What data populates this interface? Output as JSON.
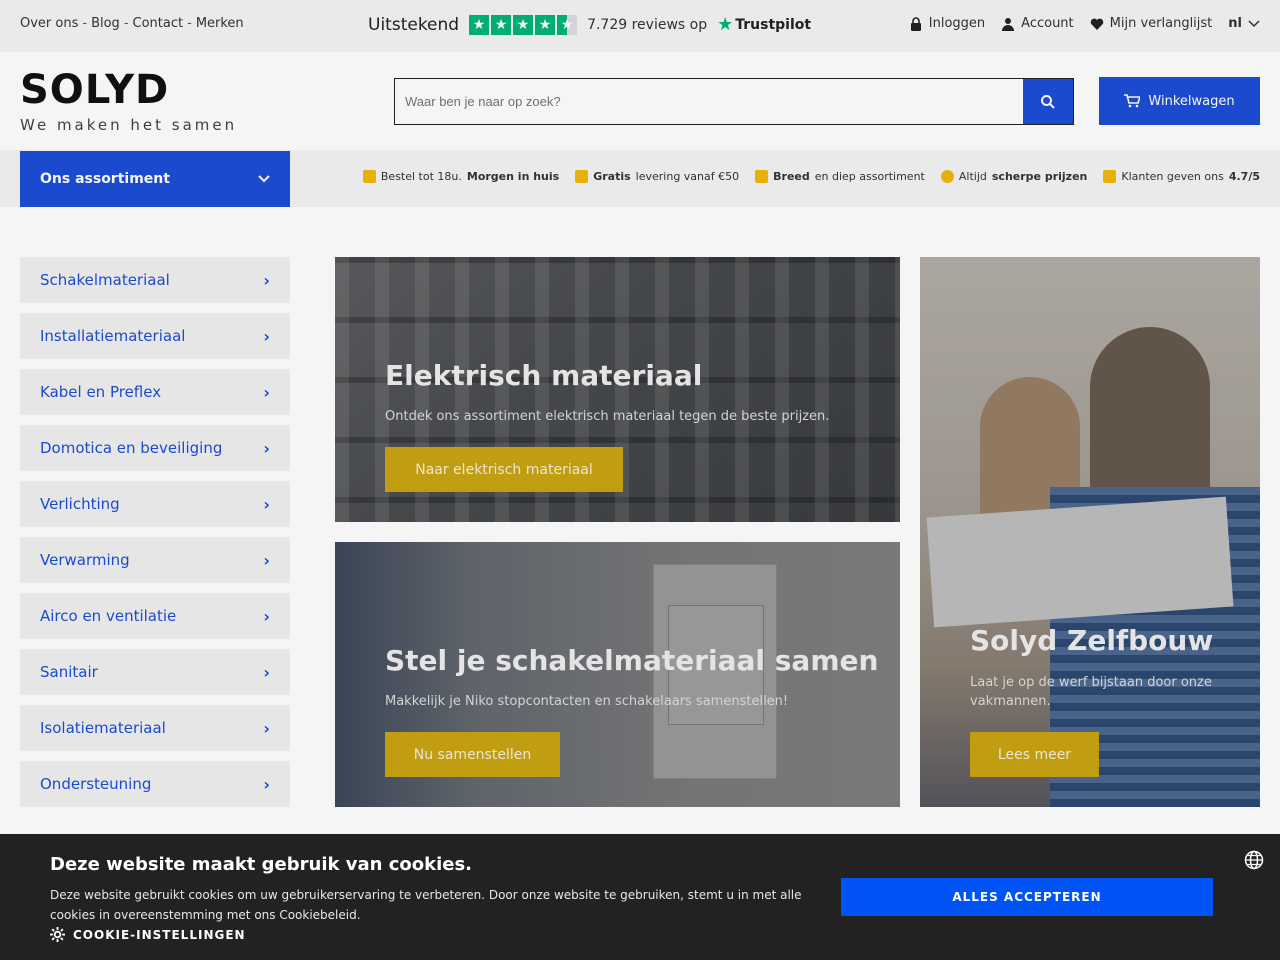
{
  "topbar": {
    "links": [
      "Over ons",
      "Blog",
      "Contact",
      "Merken"
    ],
    "separator": "-",
    "trustpilot": {
      "rating_word": "Uitstekend",
      "reviews_text": "7.729 reviews op",
      "brand": "Trustpilot",
      "stars": 4.5
    },
    "login": "Inloggen",
    "account": "Account",
    "wishlist": "Mijn verlanglijst",
    "language": "nl"
  },
  "header": {
    "logo_text": "SOLYD",
    "tagline": "We maken het samen",
    "search_placeholder": "Waar ben je naar op zoek?",
    "cart_label": "Winkelwagen",
    "accent_color": "#1d4ed8"
  },
  "nav": {
    "assortment_label": "Ons assortiment",
    "usps": [
      {
        "pre": "Bestel tot 18u.",
        "bold": "Morgen in huis",
        "post": "",
        "icon": "home-icon"
      },
      {
        "pre": "",
        "bold": "Gratis",
        "post": "levering vanaf €50",
        "icon": "truck-icon"
      },
      {
        "pre": "",
        "bold": "Breed",
        "post": "en diep assortiment",
        "icon": "box-icon"
      },
      {
        "pre": "Altijd",
        "bold": "scherpe prijzen",
        "post": "",
        "icon": "coin-icon"
      },
      {
        "pre": "Klanten geven ons",
        "bold": "4.7/5",
        "post": "",
        "icon": "chat-icon"
      }
    ]
  },
  "categories": [
    "Schakelmateriaal",
    "Installatiemateriaal",
    "Kabel en Preflex",
    "Domotica en beveiliging",
    "Verlichting",
    "Verwarming",
    "Airco en ventilatie",
    "Sanitair",
    "Isolatiemateriaal",
    "Ondersteuning"
  ],
  "banners": {
    "b1": {
      "title": "Elektrisch materiaal",
      "subtitle": "Ontdek ons assortiment elektrisch materiaal tegen de beste prijzen.",
      "button": "Naar elektrisch materiaal"
    },
    "b2": {
      "title": "Stel je schakelmateriaal samen",
      "subtitle": "Makkelijk je Niko stopcontacten en schakelaars samenstellen!",
      "button": "Nu samenstellen"
    },
    "b3": {
      "title": "Solyd Zelfbouw",
      "subtitle": "Laat je op de werf bijstaan door onze vakmannen.",
      "button": "Lees meer"
    },
    "button_color": "#c9a512"
  },
  "cookie": {
    "title": "Deze website maakt gebruik van cookies.",
    "text": "Deze website gebruikt cookies om uw gebruikerservaring te verbeteren. Door onze website te gebruiken, stemt u in met alle cookies in overeenstemming met ons Cookiebeleid.",
    "settings": "COOKIE-INSTELLINGEN",
    "accept": "ALLES ACCEPTEREN",
    "accept_color": "#0054f5"
  }
}
